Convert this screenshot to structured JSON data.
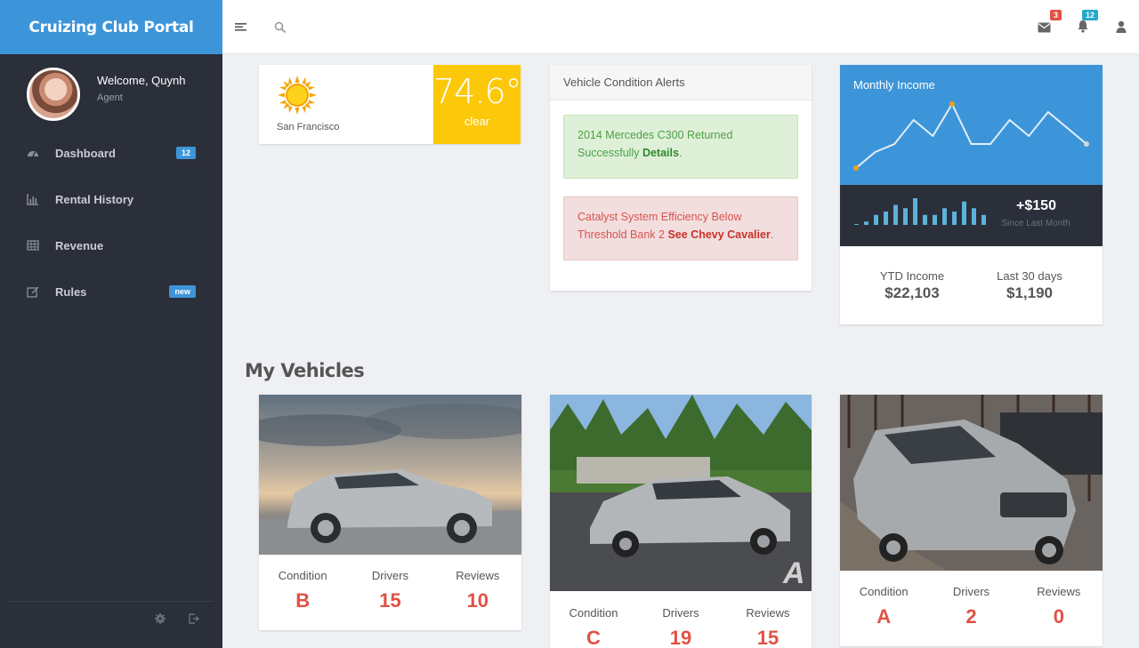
{
  "app": {
    "title": "Cruizing Club Portal"
  },
  "user": {
    "welcome": "Welcome, Quynh",
    "role": "Agent"
  },
  "sidebar": {
    "items": [
      {
        "label": "Dashboard",
        "icon": "dashboard-icon",
        "badge": "12"
      },
      {
        "label": "Rental History",
        "icon": "bar-chart-icon",
        "badge": ""
      },
      {
        "label": "Revenue",
        "icon": "table-icon",
        "badge": ""
      },
      {
        "label": "Rules",
        "icon": "edit-icon",
        "badge": "new"
      }
    ]
  },
  "topbar": {
    "mail_count": "3",
    "notification_count": "12"
  },
  "weather": {
    "city": "San Francisco",
    "temperature": "74.6°",
    "condition": "clear"
  },
  "alerts": {
    "title": "Vehicle Condition Alerts",
    "success": {
      "text": "2014 Mercedes C300 Returned Successfully ",
      "link": "Details",
      "end": "."
    },
    "danger": {
      "text": "Catalyst System Efficiency Below Threshold Bank 2 ",
      "link": "See Chevy Cavalier",
      "end": "."
    }
  },
  "income": {
    "title": "Monthly Income",
    "change": "+$150",
    "change_label": "Since Last Month",
    "ytd_label": "YTD Income",
    "ytd_value": "$22,103",
    "last30_label": "Last 30 days",
    "last30_value": "$1,190",
    "line_values": [
      2,
      4,
      5,
      8,
      6,
      10,
      5,
      5,
      8,
      6,
      9,
      7,
      5
    ],
    "bar_values": [
      1,
      3,
      4,
      6,
      5,
      8,
      3,
      3,
      5,
      4,
      7,
      5,
      3
    ]
  },
  "colors": {
    "accent": "#3d95d9",
    "danger": "#e05244",
    "weather": "#fcc80a"
  },
  "vehicles": {
    "title": "My Vehicles",
    "labels": {
      "condition": "Condition",
      "drivers": "Drivers",
      "reviews": "Reviews"
    },
    "items": [
      {
        "condition": "B",
        "drivers": "15",
        "reviews": "10"
      },
      {
        "condition": "C",
        "drivers": "19",
        "reviews": "15"
      },
      {
        "condition": "A",
        "drivers": "2",
        "reviews": "0"
      }
    ]
  }
}
